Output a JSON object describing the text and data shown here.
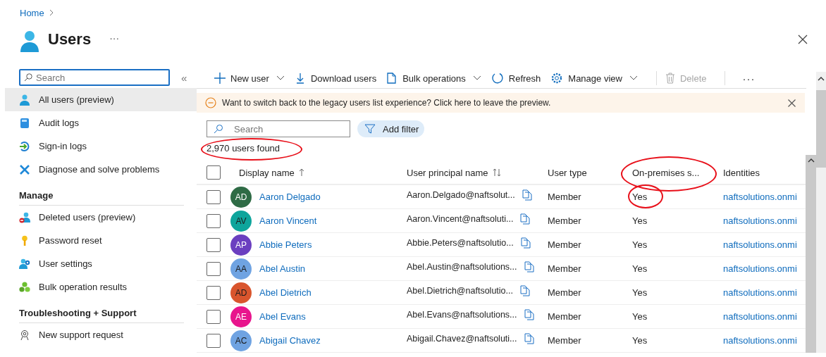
{
  "breadcrumb": [
    {
      "label": "Home"
    }
  ],
  "title": "Users",
  "title_more": "···",
  "sidebar": {
    "search": {
      "placeholder": "Search"
    },
    "collapse": "«",
    "groups": [
      {
        "items": [
          {
            "label": "All users (preview)",
            "kind": "user",
            "selected": true
          },
          {
            "label": "Audit logs",
            "kind": "book",
            "selected": false
          },
          {
            "label": "Sign-in logs",
            "kind": "signin",
            "selected": false
          },
          {
            "label": "Diagnose and solve problems",
            "kind": "tools",
            "selected": false
          }
        ]
      },
      {
        "heading": "Manage",
        "items": [
          {
            "label": "Deleted users (preview)",
            "kind": "userdel",
            "selected": false
          },
          {
            "label": "Password reset",
            "kind": "key",
            "selected": false
          },
          {
            "label": "User settings",
            "kind": "usergear",
            "selected": false
          },
          {
            "label": "Bulk operation results",
            "kind": "bulk",
            "selected": false
          }
        ]
      },
      {
        "heading": "Troubleshooting + Support",
        "items": [
          {
            "label": "New support request",
            "kind": "support",
            "selected": false
          }
        ]
      }
    ]
  },
  "toolbar": [
    {
      "label": "New user",
      "kind": "plus",
      "dropdown": true,
      "disabled": false
    },
    {
      "label": "Download users",
      "kind": "download",
      "dropdown": false,
      "disabled": false
    },
    {
      "label": "Bulk operations",
      "kind": "file",
      "dropdown": true,
      "disabled": false
    },
    {
      "label": "Refresh",
      "kind": "refresh",
      "dropdown": false,
      "disabled": false
    },
    {
      "label": "Manage view",
      "kind": "gear",
      "dropdown": true,
      "disabled": false
    },
    {
      "label": "Delete",
      "kind": "trash",
      "dropdown": false,
      "disabled": true
    }
  ],
  "toolbar_more": "···",
  "banner": {
    "text": "Want to switch back to the legacy users list experience? Click here to leave the preview."
  },
  "search": {
    "placeholder": "Search"
  },
  "add_filter": "Add filter",
  "count": {
    "text": "2,970 users found",
    "circled": true
  },
  "table": {
    "select_all": {
      "checked": false
    },
    "columns": [
      {
        "label": "Display name",
        "kind": "asc",
        "circled": false
      },
      {
        "label": "User principal name",
        "kind": "both",
        "circled": false
      },
      {
        "label": "User type",
        "kind": "plain",
        "circled": false
      },
      {
        "label": "On-premises s...",
        "kind": "plain",
        "circled": true
      },
      {
        "label": "Identities",
        "kind": "plain",
        "circled": false
      }
    ],
    "rows": [
      {
        "checked": false,
        "initials": "AD",
        "color": "#2e6b45",
        "name": "Aaron Delgado",
        "upn": "Aaron.Delgado@naftsolut...",
        "user_type": "Member",
        "on_premises": "Yes",
        "on_premises_circled": true,
        "identities": "naftsolutions.onmi"
      },
      {
        "checked": false,
        "initials": "AV",
        "color": "#0ea59c",
        "name": "Aaron Vincent",
        "upn": "Aaron.Vincent@naftsoluti...",
        "user_type": "Member",
        "on_premises": "Yes",
        "on_premises_circled": false,
        "identities": "naftsolutions.onmi"
      },
      {
        "checked": false,
        "initials": "AP",
        "color": "#6b3fc0",
        "name": "Abbie Peters",
        "upn": "Abbie.Peters@naftsolutio...",
        "user_type": "Member",
        "on_premises": "Yes",
        "on_premises_circled": false,
        "identities": "naftsolutions.onmi"
      },
      {
        "checked": false,
        "initials": "AA",
        "color": "#6fa3e2",
        "name": "Abel Austin",
        "upn": "Abel.Austin@naftsolutions...",
        "user_type": "Member",
        "on_premises": "Yes",
        "on_premises_circled": false,
        "identities": "naftsolutions.onmi"
      },
      {
        "checked": false,
        "initials": "AD",
        "color": "#d9552d",
        "name": "Abel Dietrich",
        "upn": "Abel.Dietrich@naftsolutio...",
        "user_type": "Member",
        "on_premises": "Yes",
        "on_premises_circled": false,
        "identities": "naftsolutions.onmi"
      },
      {
        "checked": false,
        "initials": "AE",
        "color": "#e8158d",
        "name": "Abel Evans",
        "upn": "Abel.Evans@naftsolutions...",
        "user_type": "Member",
        "on_premises": "Yes",
        "on_premises_circled": false,
        "identities": "naftsolutions.onmi"
      },
      {
        "checked": false,
        "initials": "AC",
        "color": "#6fa3e2",
        "name": "Abigail Chavez",
        "upn": "Abigail.Chavez@naftsoluti...",
        "user_type": "Member",
        "on_premises": "Yes",
        "on_premises_circled": false,
        "identities": "naftsolutions.onmi"
      }
    ]
  }
}
